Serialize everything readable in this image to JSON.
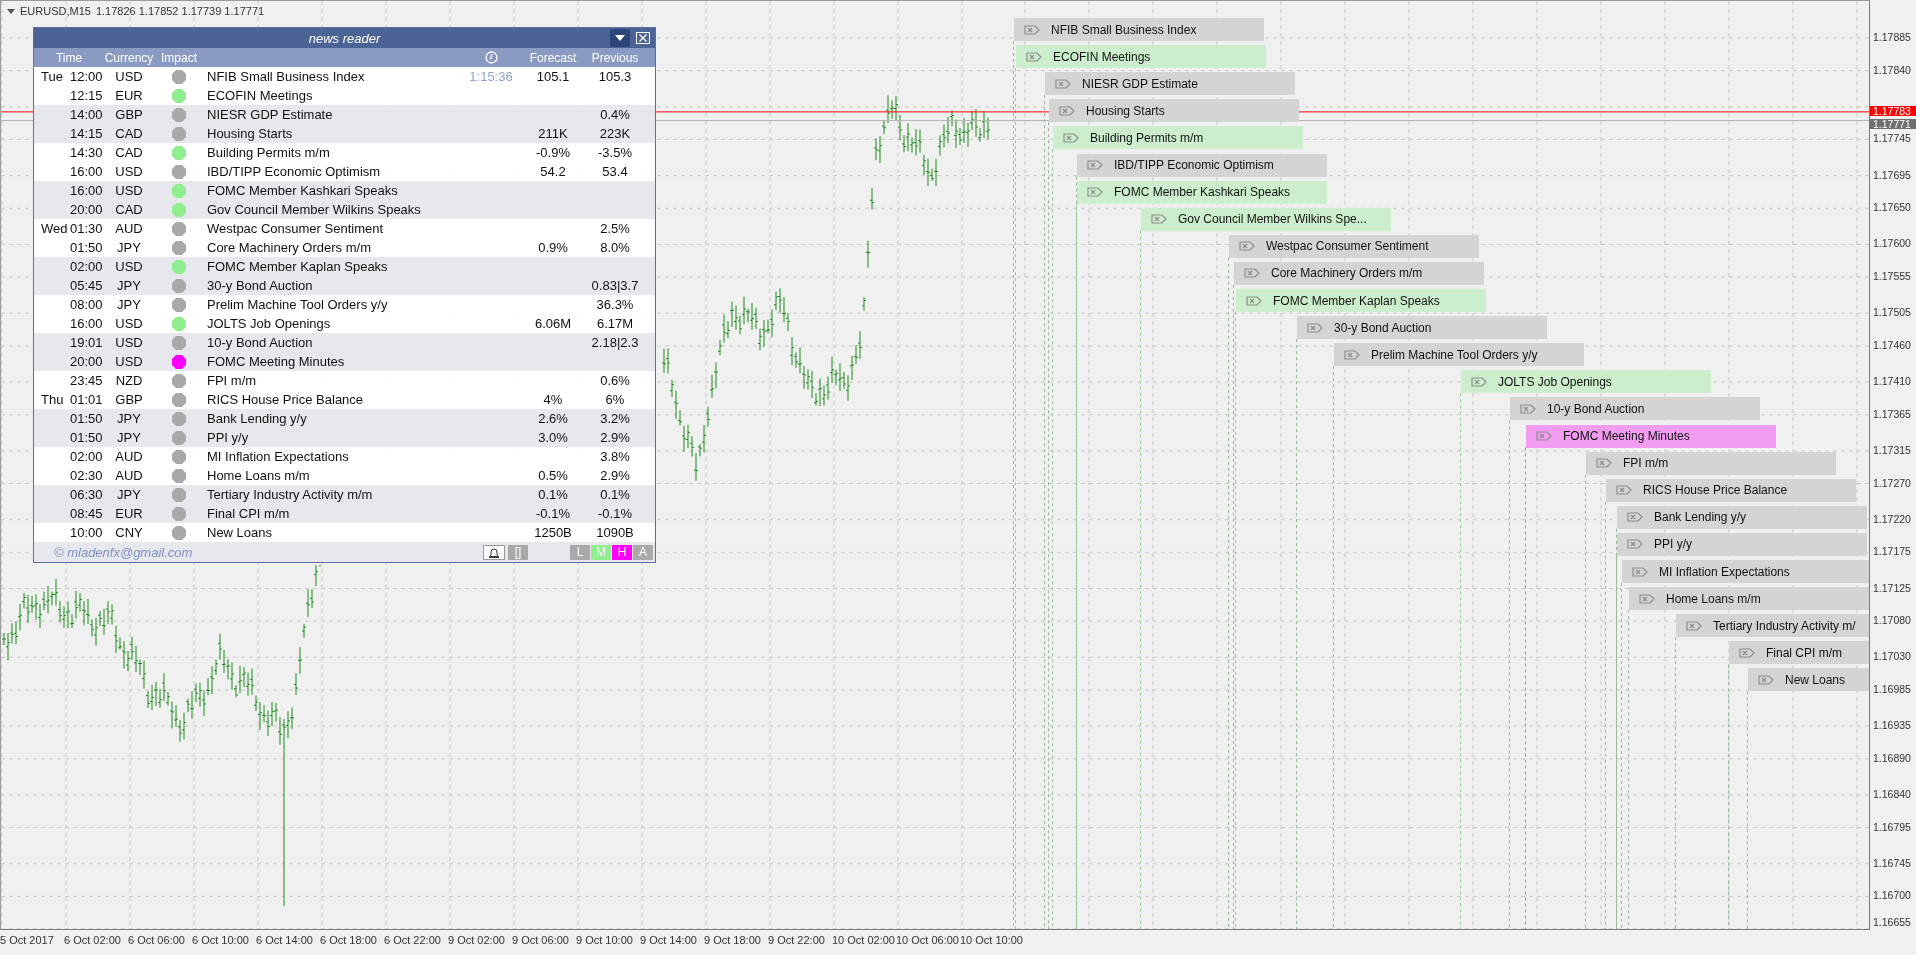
{
  "chart": {
    "symbol": "EURUSD,M15",
    "ohlc": "1.17826 1.17852 1.17739 1.17771"
  },
  "price_axis": {
    "labels": [
      "1.17885",
      "1.17840",
      "1.17745",
      "1.17695",
      "1.17650",
      "1.17600",
      "1.17555",
      "1.17505",
      "1.17460",
      "1.17410",
      "1.17365",
      "1.17315",
      "1.17270",
      "1.17220",
      "1.17175",
      "1.17125",
      "1.17080",
      "1.17030",
      "1.16985",
      "1.16935",
      "1.16890",
      "1.16840",
      "1.16795",
      "1.16745",
      "1.16700",
      "1.16655"
    ],
    "line_price": "1.17783",
    "last_price": "1.17771"
  },
  "time_axis": {
    "labels": [
      "5 Oct 2017",
      "6 Oct 02:00",
      "6 Oct 06:00",
      "6 Oct 10:00",
      "6 Oct 14:00",
      "6 Oct 18:00",
      "6 Oct 22:00",
      "9 Oct 02:00",
      "9 Oct 06:00",
      "9 Oct 10:00",
      "9 Oct 14:00",
      "9 Oct 18:00",
      "9 Oct 22:00",
      "10 Oct 02:00",
      "10 Oct 06:00",
      "10 Oct 10:00"
    ]
  },
  "news_reader": {
    "title": "news reader",
    "columns": [
      {
        "kind": "time",
        "label": "Time"
      },
      {
        "kind": "currency",
        "label": "Currency"
      },
      {
        "kind": "impact",
        "label": "Impact"
      },
      {
        "kind": "forecast",
        "label": "Forecast"
      },
      {
        "kind": "previous",
        "label": "Previous"
      }
    ],
    "rows": [
      {
        "day": "Tue",
        "time": "12:00",
        "currency": "USD",
        "color": "#a9a9a9",
        "event": "NFIB Small Business Index",
        "countdown": "1:15:36",
        "forecast": "105.1",
        "previous": "105.3"
      },
      {
        "time": "12:15",
        "currency": "EUR",
        "color": "#90ee90",
        "event": "ECOFIN Meetings"
      },
      {
        "time": "14:00",
        "currency": "GBP",
        "color": "#a9a9a9",
        "event": "NIESR GDP Estimate",
        "previous": "0.4%"
      },
      {
        "time": "14:15",
        "currency": "CAD",
        "color": "#a9a9a9",
        "event": "Housing Starts",
        "forecast": "211K",
        "previous": "223K"
      },
      {
        "time": "14:30",
        "currency": "CAD",
        "color": "#90ee90",
        "event": "Building Permits m/m",
        "forecast": "-0.9%",
        "previous": "-3.5%"
      },
      {
        "time": "16:00",
        "currency": "USD",
        "color": "#a9a9a9",
        "event": "IBD/TIPP Economic Optimism",
        "forecast": "54.2",
        "previous": "53.4"
      },
      {
        "time": "16:00",
        "currency": "USD",
        "color": "#90ee90",
        "event": "FOMC Member Kashkari Speaks"
      },
      {
        "time": "20:00",
        "currency": "CAD",
        "color": "#90ee90",
        "event": "Gov Council Member Wilkins Speaks"
      },
      {
        "day": "Wed",
        "time": "01:30",
        "currency": "AUD",
        "color": "#a9a9a9",
        "event": "Westpac Consumer Sentiment",
        "previous": "2.5%"
      },
      {
        "time": "01:50",
        "currency": "JPY",
        "color": "#a9a9a9",
        "event": "Core Machinery Orders m/m",
        "forecast": "0.9%",
        "previous": "8.0%"
      },
      {
        "time": "02:00",
        "currency": "USD",
        "color": "#90ee90",
        "event": "FOMC Member Kaplan Speaks"
      },
      {
        "time": "05:45",
        "currency": "JPY",
        "color": "#a9a9a9",
        "event": "30-y Bond Auction",
        "previous": "0.83|3.7"
      },
      {
        "time": "08:00",
        "currency": "JPY",
        "color": "#a9a9a9",
        "event": "Prelim Machine Tool Orders y/y",
        "previous": "36.3%"
      },
      {
        "time": "16:00",
        "currency": "USD",
        "color": "#90ee90",
        "event": "JOLTS Job Openings",
        "forecast": "6.06M",
        "previous": "6.17M"
      },
      {
        "time": "19:01",
        "currency": "USD",
        "color": "#a9a9a9",
        "event": "10-y Bond Auction",
        "previous": "2.18|2.3"
      },
      {
        "time": "20:00",
        "currency": "USD",
        "color": "#ff00ff",
        "event": "FOMC Meeting Minutes"
      },
      {
        "time": "23:45",
        "currency": "NZD",
        "color": "#a9a9a9",
        "event": "FPI m/m",
        "previous": "0.6%"
      },
      {
        "day": "Thu",
        "time": "01:01",
        "currency": "GBP",
        "color": "#a9a9a9",
        "event": "RICS House Price Balance",
        "forecast": "4%",
        "previous": "6%"
      },
      {
        "time": "01:50",
        "currency": "JPY",
        "color": "#a9a9a9",
        "event": "Bank Lending y/y",
        "forecast": "2.6%",
        "previous": "3.2%"
      },
      {
        "time": "01:50",
        "currency": "JPY",
        "color": "#a9a9a9",
        "event": "PPI y/y",
        "forecast": "3.0%",
        "previous": "2.9%"
      },
      {
        "time": "02:00",
        "currency": "AUD",
        "color": "#a9a9a9",
        "event": "MI Inflation Expectations",
        "previous": "3.8%"
      },
      {
        "time": "02:30",
        "currency": "AUD",
        "color": "#a9a9a9",
        "event": "Home Loans m/m",
        "forecast": "0.5%",
        "previous": "2.9%"
      },
      {
        "time": "06:30",
        "currency": "JPY",
        "color": "#a9a9a9",
        "event": "Tertiary Industry Activity m/m",
        "forecast": "0.1%",
        "previous": "0.1%"
      },
      {
        "time": "08:45",
        "currency": "EUR",
        "color": "#a9a9a9",
        "event": "Final CPI m/m",
        "forecast": "-0.1%",
        "previous": "-0.1%"
      },
      {
        "time": "10:00",
        "currency": "CNY",
        "color": "#a9a9a9",
        "event": "New Loans",
        "forecast": "1250B",
        "previous": "1090B"
      }
    ],
    "footer": {
      "credit": "© mladenfx@gmail.com",
      "toggle_label": "[]",
      "filters": [
        {
          "label": "L",
          "color": "#a9a9a9"
        },
        {
          "label": "M",
          "color": "#90ee90"
        },
        {
          "label": "H",
          "color": "#ff00ff"
        },
        {
          "label": "A",
          "color": "#a9a9a9"
        }
      ]
    }
  },
  "events": [
    {
      "title": "NFIB Small Business Index",
      "color": "#d4d4d4"
    },
    {
      "title": "ECOFIN Meetings",
      "color": "#cdeecd"
    },
    {
      "title": "NIESR GDP Estimate",
      "color": "#d4d4d4"
    },
    {
      "title": "Housing Starts",
      "color": "#d4d4d4"
    },
    {
      "title": "Building Permits m/m",
      "color": "#cdeecd"
    },
    {
      "title": "IBD/TIPP Economic Optimism",
      "color": "#d4d4d4"
    },
    {
      "title": "FOMC Member Kashkari Speaks",
      "color": "#cdeecd"
    },
    {
      "title": "Gov Council Member Wilkins Spe...",
      "color": "#cdeecd"
    },
    {
      "title": "Westpac Consumer Sentiment",
      "color": "#d4d4d4"
    },
    {
      "title": "Core Machinery Orders m/m",
      "color": "#d4d4d4"
    },
    {
      "title": "FOMC Member Kaplan Speaks",
      "color": "#cdeecd"
    },
    {
      "title": "30-y Bond Auction",
      "color": "#d4d4d4"
    },
    {
      "title": "Prelim Machine Tool Orders y/y",
      "color": "#d4d4d4"
    },
    {
      "title": "JOLTS Job Openings",
      "color": "#cdeecd"
    },
    {
      "title": "10-y Bond Auction",
      "color": "#d4d4d4"
    },
    {
      "title": "FOMC Meeting Minutes",
      "color": "#f29cf2"
    },
    {
      "title": "FPI m/m",
      "color": "#d4d4d4"
    },
    {
      "title": "RICS House Price Balance",
      "color": "#d4d4d4"
    },
    {
      "title": "Bank Lending y/y",
      "color": "#d4d4d4"
    },
    {
      "title": "PPI y/y",
      "color": "#d4d4d4"
    },
    {
      "title": "MI Inflation Expectations",
      "color": "#d4d4d4"
    },
    {
      "title": "Home Loans m/m",
      "color": "#d4d4d4"
    },
    {
      "title": "Tertiary Industry Activity m/",
      "color": "#d4d4d4"
    },
    {
      "title": "Final CPI m/m",
      "color": "#d4d4d4"
    },
    {
      "title": "New Loans",
      "color": "#d4d4d4"
    }
  ]
}
